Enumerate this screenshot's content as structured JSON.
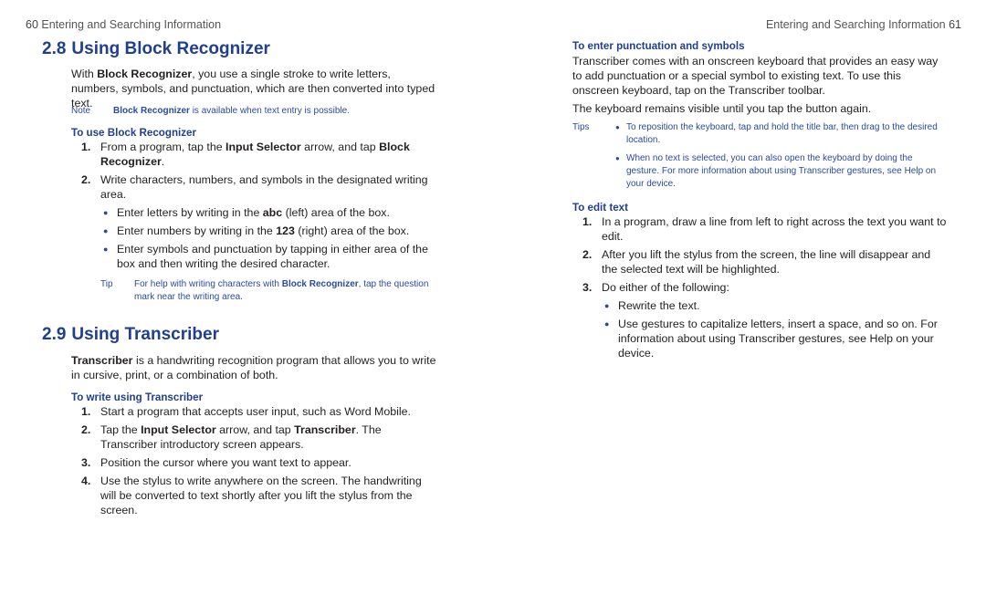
{
  "left_page": {
    "page_number": "60",
    "running_head": "Entering and Searching Information",
    "section_1": {
      "number": "2.8",
      "title": "Using Block Recognizer",
      "intro_bold": "Block Recognizer",
      "intro_pre": "With ",
      "intro_post": ", you use a single stroke to write letters, numbers, symbols, and punctuation, which are then converted into typed text.",
      "note_label": "Note",
      "note_bold": "Block Recognizer",
      "note_text": " is available when text entry is possible.",
      "subhead": "To use Block Recognizer",
      "steps": [
        {
          "n": "1.",
          "pre": "From a program, tap the ",
          "b1": "Input Selector",
          "mid": " arrow, and tap ",
          "b2": "Block Recognizer",
          "post": "."
        },
        {
          "n": "2.",
          "text": "Write characters, numbers, and symbols in the designated writing area."
        }
      ],
      "bullets": [
        {
          "pre": "Enter letters by writing in the ",
          "b": "abc",
          "post": " (left) area of the box."
        },
        {
          "pre": "Enter numbers by writing in the ",
          "b": "123",
          "post": " (right) area of the box."
        },
        {
          "pre": "Enter symbols and punctuation by tapping in either area of the box and then writing the desired character.",
          "b": "",
          "post": ""
        }
      ],
      "tip_label": "Tip",
      "tip_pre": "For help with writing characters with ",
      "tip_bold": "Block Recognizer",
      "tip_post": ", tap the question mark near the writing area."
    },
    "section_2": {
      "number": "2.9",
      "title": "Using Transcriber",
      "intro_bold": "Transcriber",
      "intro_post": " is a handwriting recognition program that allows you to write in cursive, print, or a combination of both.",
      "subhead": "To write using Transcriber",
      "steps": [
        {
          "n": "1.",
          "pre": "Start a program that accepts user input, such as Word Mobile.",
          "b1": "",
          "mid": "",
          "b2": "",
          "post": ""
        },
        {
          "n": "2.",
          "pre": "Tap the ",
          "b1": "Input Selector",
          "mid": " arrow, and tap ",
          "b2": "Transcriber",
          "post": ". The Transcriber introductory screen appears."
        },
        {
          "n": "3.",
          "pre": "Position the cursor where you want text to appear.",
          "b1": "",
          "mid": "",
          "b2": "",
          "post": ""
        },
        {
          "n": "4.",
          "pre": "Use the stylus to write anywhere on the screen. The handwriting will be converted to text shortly after you lift the stylus from the screen.",
          "b1": "",
          "mid": "",
          "b2": "",
          "post": ""
        }
      ]
    }
  },
  "right_page": {
    "page_number": "61",
    "running_head": "Entering and Searching Information",
    "punct": {
      "subhead": "To enter punctuation and symbols",
      "para1": "Transcriber comes with an onscreen keyboard that provides an easy way to add punctuation or a special symbol to existing text. To use this onscreen keyboard, tap       on the Transcriber toolbar.",
      "para2": "The keyboard remains visible until you tap the button again.",
      "tips_label": "Tips",
      "tips": [
        "To reposition the keyboard, tap and hold the title bar, then drag to the desired location.",
        "When no text is selected, you can also open the keyboard by doing the gesture. For more information about using Transcriber gestures, see Help on your device."
      ]
    },
    "edit": {
      "subhead": "To edit text",
      "steps": [
        {
          "n": "1.",
          "text": "In a program, draw a line from left to right across the text you want to edit."
        },
        {
          "n": "2.",
          "text": "After you lift the stylus from the screen, the line will disappear and the selected text will be highlighted."
        },
        {
          "n": "3.",
          "text": "Do either of the following:"
        }
      ],
      "bullets": [
        "Rewrite the text.",
        "Use gestures to capitalize letters, insert a space, and so on. For information about using Transcriber gestures, see Help on your device."
      ]
    }
  }
}
